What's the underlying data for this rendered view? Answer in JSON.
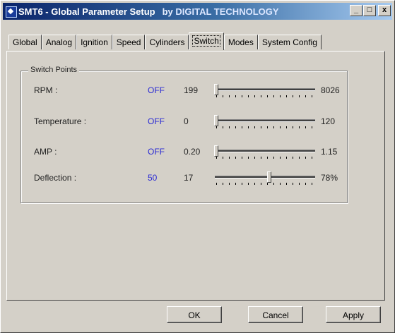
{
  "window": {
    "title": "SMT6 - Global Parameter Setup",
    "by": "by",
    "company": "DIGITAL TECHNOLOGY",
    "minimize": "_",
    "maximize": "□",
    "close": "x"
  },
  "tabs": [
    "Global",
    "Analog",
    "Ignition",
    "Speed",
    "Cylinders",
    "Switch",
    "Modes",
    "System Config"
  ],
  "active_tab": "Switch",
  "group": {
    "label": "Switch Points",
    "rows": [
      {
        "label": "RPM :",
        "status": "OFF",
        "min": "199",
        "max": "8026",
        "level": 0.0
      },
      {
        "label": "Temperature :",
        "status": "OFF",
        "min": "0",
        "max": "120",
        "level": 0.0
      },
      {
        "label": "AMP :",
        "status": "OFF",
        "min": "0.20",
        "max": "1.15",
        "level": 0.0
      },
      {
        "label": "Deflection :",
        "status": "50",
        "min": "17",
        "max": "78%",
        "level": 0.54
      }
    ]
  },
  "buttons": {
    "ok": "OK",
    "cancel": "Cancel",
    "apply": "Apply"
  }
}
